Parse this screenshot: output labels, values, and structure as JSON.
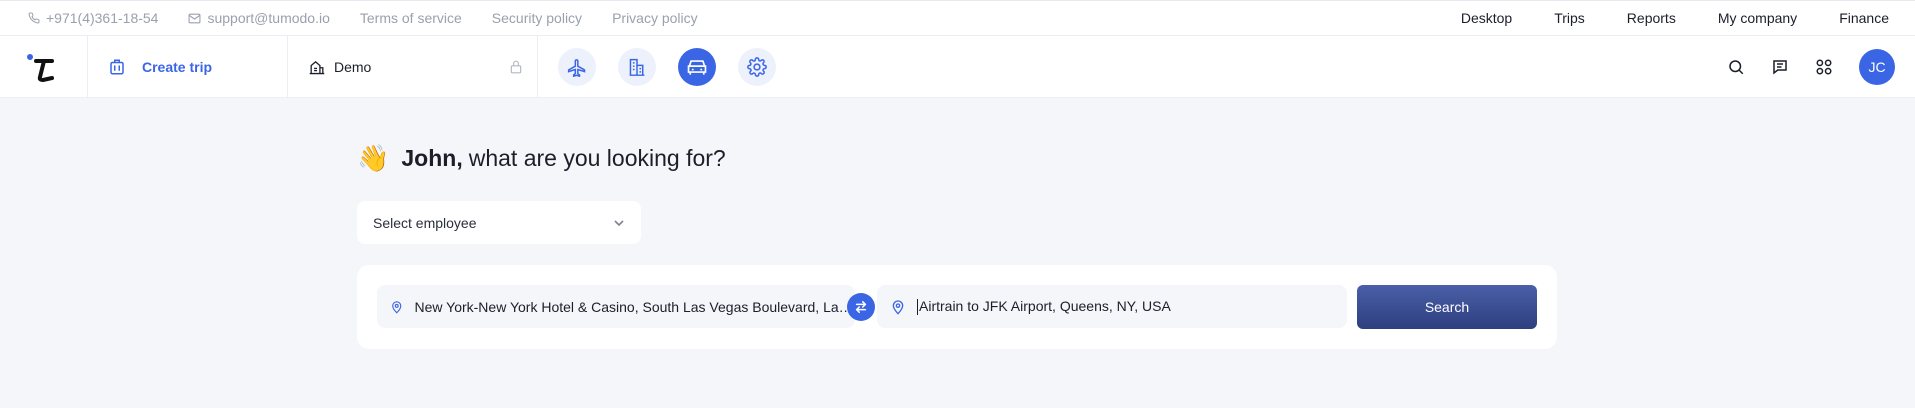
{
  "topbar": {
    "phone": "+971(4)361-18-54",
    "email": "support@tumodo.io",
    "terms": "Terms of service",
    "security": "Security policy",
    "privacy": "Privacy policy",
    "nav": [
      "Desktop",
      "Trips",
      "Reports",
      "My company",
      "Finance"
    ]
  },
  "header": {
    "create_trip": "Create trip",
    "company": "Demo",
    "modes": [
      "plane-icon",
      "hotel-icon",
      "car-icon",
      "gear-icon"
    ],
    "active_mode": "car-icon",
    "avatar": "JC"
  },
  "greeting": {
    "emoji": "👋",
    "name": "John,",
    "text": "what are you looking for?"
  },
  "employee_select": {
    "placeholder": "Select employee"
  },
  "search": {
    "from": "New York-New York Hotel & Casino, South Las Vegas Boulevard, Las Vegas, NV, USA",
    "to": "Airtrain to JFK Airport, Queens, NY, USA",
    "button": "Search"
  },
  "colors": {
    "accent": "#3a66e5",
    "button": "#2e3f7f"
  }
}
